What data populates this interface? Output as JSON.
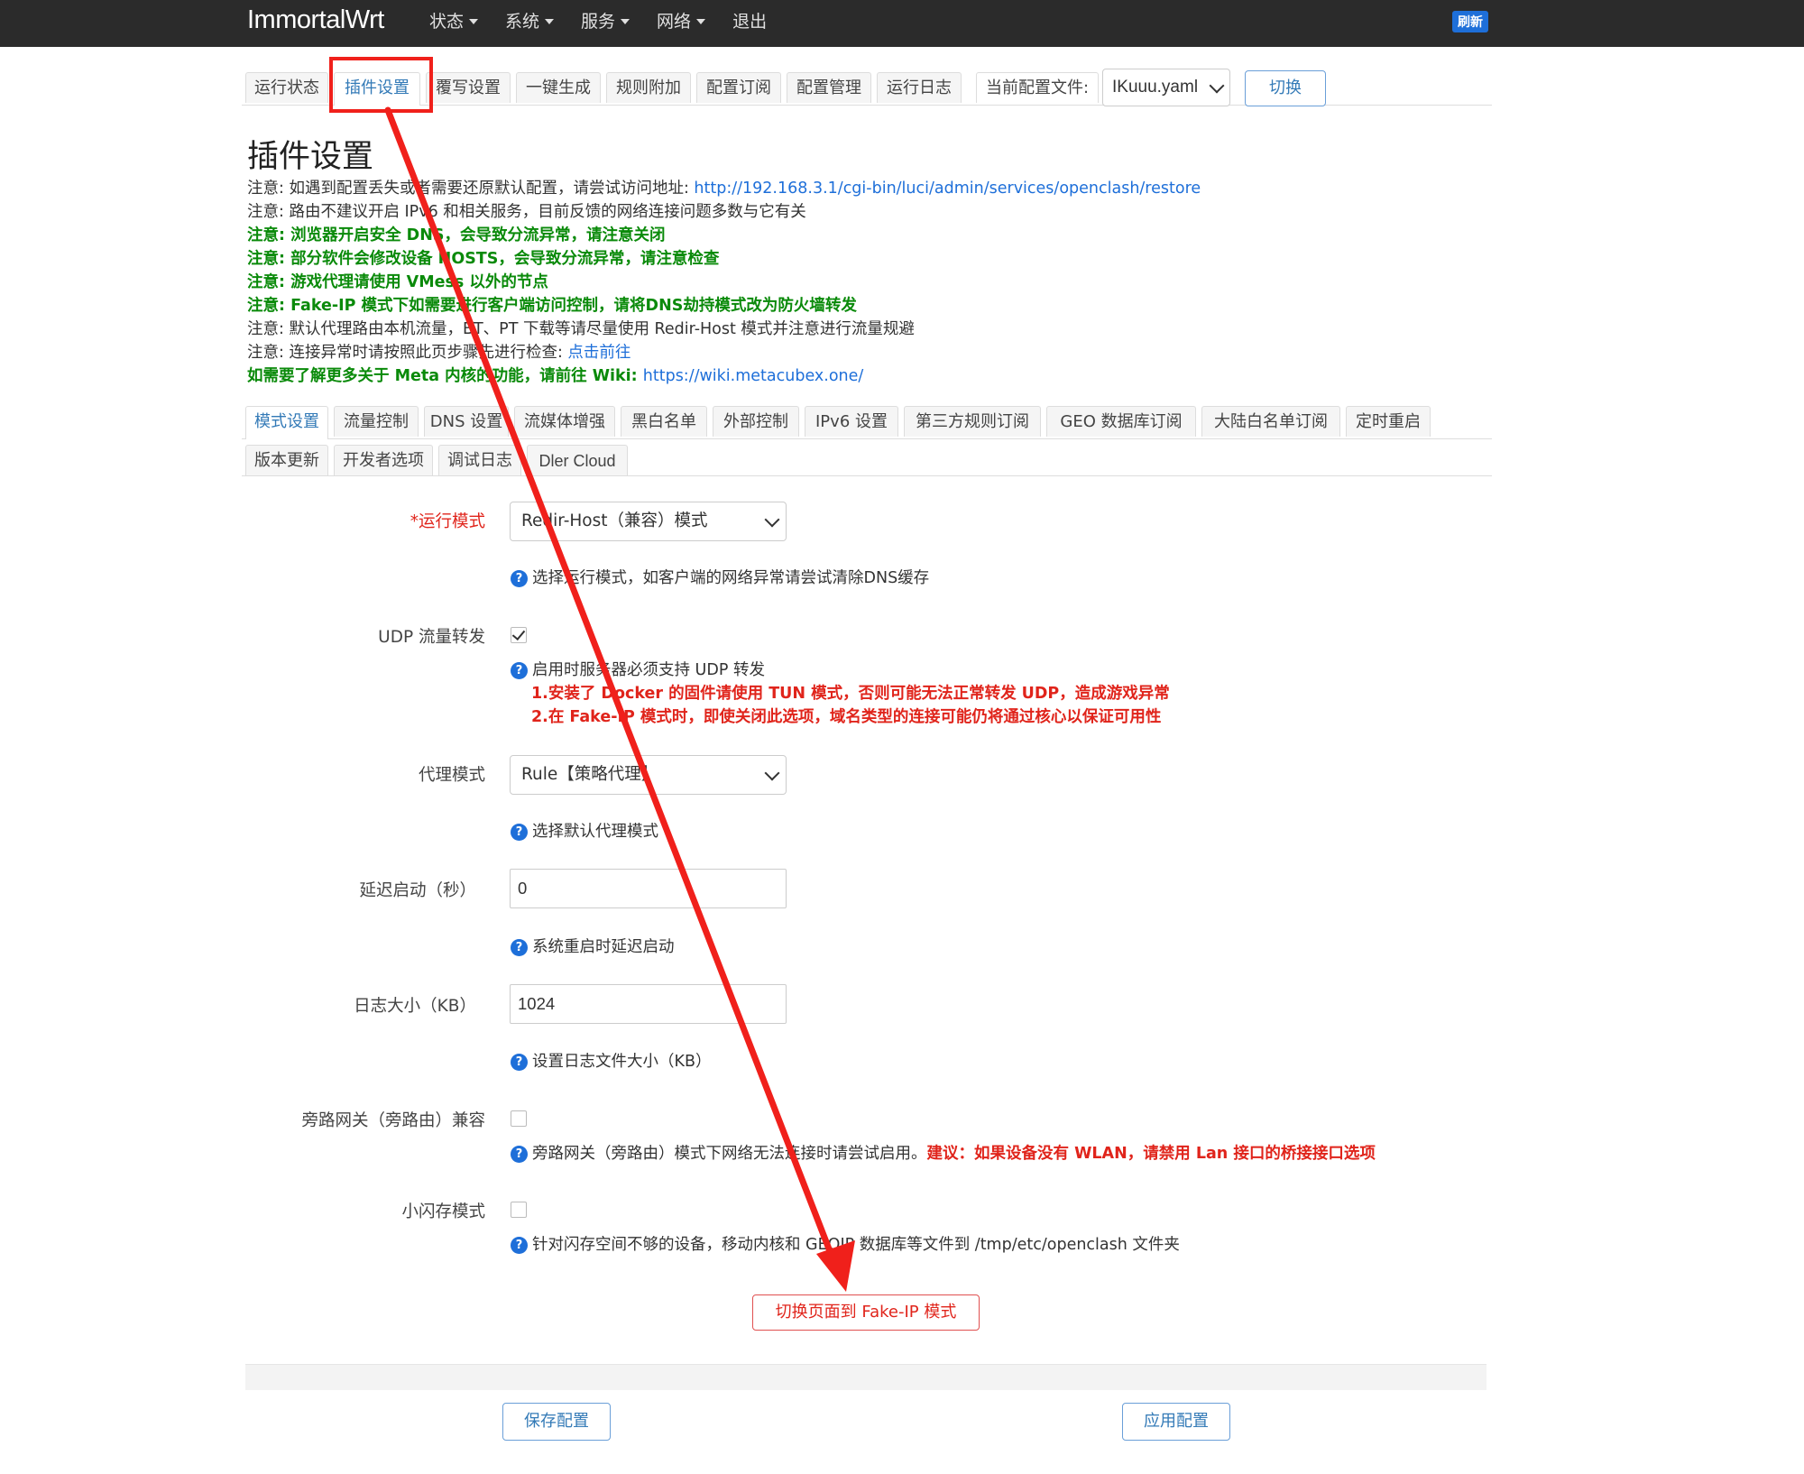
{
  "navbar": {
    "brand": "ImmortalWrt",
    "menu": [
      "状态",
      "系统",
      "服务",
      "网络"
    ],
    "logout": "退出",
    "refresh": "刷新"
  },
  "top_tabs": [
    "运行状态",
    "插件设置",
    "覆写设置",
    "一键生成",
    "规则附加",
    "配置订阅",
    "配置管理",
    "运行日志",
    "当前配置文件:"
  ],
  "active_top_tab": "插件设置",
  "config_file": {
    "selected": "IKuuu.yaml",
    "switch_label": "切换"
  },
  "page_title": "插件设置",
  "notes": {
    "n1_prefix": "注意: 如遇到配置丢失或者需要还原默认配置，请尝试访问地址: ",
    "n1_link": "http://192.168.3.1/cgi-bin/luci/admin/services/openclash/restore",
    "n2": "注意: 路由不建议开启 IPv6 和相关服务，目前反馈的网络连接问题多数与它有关",
    "n3": "注意: 浏览器开启安全 DNS，会导致分流异常，请注意关闭",
    "n4": "注意: 部分软件会修改设备 HOSTS，会导致分流异常，请注意检查",
    "n5": "注意: 游戏代理请使用 VMess 以外的节点",
    "n6": "注意: Fake-IP 模式下如需要进行客户端访问控制，请将DNS劫持模式改为防火墙转发",
    "n7": "注意: 默认代理路由本机流量，BT、PT 下载等请尽量使用 Redir-Host 模式并注意进行流量规避",
    "n8_prefix": "注意: 连接异常时请按照此页步骤先进行检查: ",
    "n8_link": "点击前往",
    "n9_prefix": "如需要了解更多关于 Meta 内核的功能，请前往 Wiki: ",
    "n9_link": "https://wiki.metacubex.one/"
  },
  "section_tabs_row1": [
    "模式设置",
    "流量控制",
    "DNS 设置",
    "流媒体增强",
    "黑白名单",
    "外部控制",
    "IPv6 设置",
    "第三方规则订阅",
    "GEO 数据库订阅",
    "大陆白名单订阅",
    "定时重启"
  ],
  "section_tabs_row2": [
    "版本更新",
    "开发者选项",
    "调试日志",
    "Dler Cloud"
  ],
  "fields": {
    "run_mode": {
      "label": "*运行模式",
      "value": "Redir-Host（兼容）模式",
      "help": "选择运行模式，如客户端的网络异常请尝试清除DNS缓存"
    },
    "udp": {
      "label": "UDP 流量转发",
      "checked": true,
      "help": "启用时服务器必须支持 UDP 转发",
      "warn1": "1.安装了 Docker 的固件请使用 TUN 模式，否则可能无法正常转发 UDP，造成游戏异常",
      "warn2": "2.在 Fake-IP 模式时，即使关闭此选项，域名类型的连接可能仍将通过核心以保证可用性"
    },
    "proxy_mode": {
      "label": "代理模式",
      "value": "Rule【策略代理】",
      "help": "选择默认代理模式"
    },
    "delay_start": {
      "label": "延迟启动（秒）",
      "value": "0",
      "help": "系统重启时延迟启动"
    },
    "log_size": {
      "label": "日志大小（KB）",
      "value": "1024",
      "help": "设置日志文件大小（KB）"
    },
    "bypass_gateway": {
      "label": "旁路网关（旁路由）兼容",
      "checked": false,
      "help": "旁路网关（旁路由）模式下网络无法连接时请尝试启用。",
      "help_red": "建议：如果设备没有 WLAN，请禁用 Lan 接口的桥接接口选项"
    },
    "small_flash": {
      "label": "小闪存模式",
      "checked": false,
      "help": "针对闪存空间不够的设备，移动内核和 GEOIP 数据库等文件到 /tmp/etc/openclash 文件夹"
    }
  },
  "switch_fakeip_button": "切换页面到 Fake-IP 模式",
  "save_button": "保存配置",
  "apply_button": "应用配置",
  "colors": {
    "accent": "#337ab7",
    "link": "#1e6fd9",
    "warning_red": "#e0241b",
    "note_green": "#0a8a0a",
    "annotation_red": "#f0201b",
    "navbar_bg": "#2b2b2b"
  }
}
